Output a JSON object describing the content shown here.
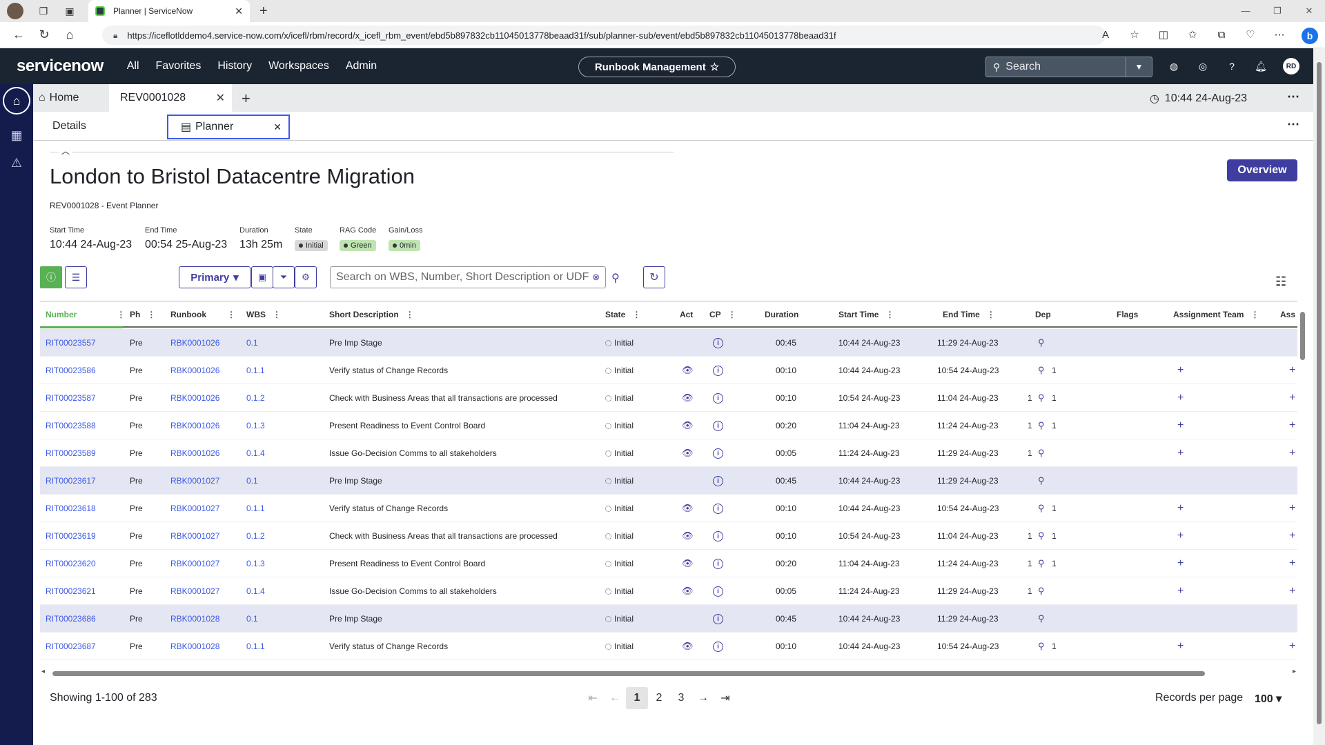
{
  "browser": {
    "tab_title": "Planner | ServiceNow",
    "url": "https://iceflotlddemo4.service-now.com/x/icefl/rbm/record/x_icefl_rbm_event/ebd5b897832cb11045013778beaad31f/sub/planner-sub/event/ebd5b897832cb11045013778beaad31f"
  },
  "header": {
    "logo": "servicenow",
    "nav": [
      "All",
      "Favorites",
      "History",
      "Workspaces",
      "Admin"
    ],
    "context": "Runbook Management",
    "search_label": "Search",
    "user_initials": "RD"
  },
  "workspace_tabs": {
    "home": "Home",
    "record": "REV0001028",
    "time": "10:44 24-Aug-23"
  },
  "sub_tabs": {
    "details": "Details",
    "planner": "Planner"
  },
  "page": {
    "title": "London to Bristol Datacentre Migration",
    "subtitle": "REV0001028 - Event Planner",
    "overview_button": "Overview"
  },
  "meta": {
    "start_time_label": "Start Time",
    "start_time": "10:44 24-Aug-23",
    "end_time_label": "End Time",
    "end_time": "00:54 25-Aug-23",
    "duration_label": "Duration",
    "duration": "13h 25m",
    "state_label": "State",
    "state": "Initial",
    "rag_label": "RAG Code",
    "rag": "Green",
    "gain_label": "Gain/Loss",
    "gain": "0min"
  },
  "toolbar": {
    "primary": "Primary",
    "search_placeholder": "Search on WBS, Number, Short Description or UDF"
  },
  "table": {
    "headers": {
      "number": "Number",
      "phase": "Ph",
      "runbook": "Runbook",
      "wbs": "WBS",
      "desc": "Short Description",
      "state": "State",
      "act": "Act",
      "cp": "CP",
      "duration": "Duration",
      "start": "Start Time",
      "end": "End Time",
      "dep": "Dep",
      "flags": "Flags",
      "team": "Assignment Team",
      "ass": "Ass"
    },
    "rows": [
      {
        "number": "RIT00023557",
        "phase": "Pre",
        "runbook": "RBK0001026",
        "wbs": "0.1",
        "desc": "Pre Imp Stage",
        "state": "Initial",
        "act": false,
        "duration": "00:45",
        "start": "10:44 24-Aug-23",
        "end": "11:29 24-Aug-23",
        "dep_pre": "",
        "dep_post": "",
        "stage": true
      },
      {
        "number": "RIT00023586",
        "phase": "Pre",
        "runbook": "RBK0001026",
        "wbs": "0.1.1",
        "desc": "Verify status of Change Records",
        "state": "Initial",
        "act": true,
        "duration": "00:10",
        "start": "10:44 24-Aug-23",
        "end": "10:54 24-Aug-23",
        "dep_pre": "",
        "dep_post": "1",
        "stage": false
      },
      {
        "number": "RIT00023587",
        "phase": "Pre",
        "runbook": "RBK0001026",
        "wbs": "0.1.2",
        "desc": "Check with Business Areas that all transactions are processed",
        "state": "Initial",
        "act": true,
        "duration": "00:10",
        "start": "10:54 24-Aug-23",
        "end": "11:04 24-Aug-23",
        "dep_pre": "1",
        "dep_post": "1",
        "stage": false
      },
      {
        "number": "RIT00023588",
        "phase": "Pre",
        "runbook": "RBK0001026",
        "wbs": "0.1.3",
        "desc": "Present Readiness to Event Control Board",
        "state": "Initial",
        "act": true,
        "duration": "00:20",
        "start": "11:04 24-Aug-23",
        "end": "11:24 24-Aug-23",
        "dep_pre": "1",
        "dep_post": "1",
        "stage": false
      },
      {
        "number": "RIT00023589",
        "phase": "Pre",
        "runbook": "RBK0001026",
        "wbs": "0.1.4",
        "desc": "Issue Go-Decision Comms to all stakeholders",
        "state": "Initial",
        "act": true,
        "duration": "00:05",
        "start": "11:24 24-Aug-23",
        "end": "11:29 24-Aug-23",
        "dep_pre": "1",
        "dep_post": "",
        "stage": false
      },
      {
        "number": "RIT00023617",
        "phase": "Pre",
        "runbook": "RBK0001027",
        "wbs": "0.1",
        "desc": "Pre Imp Stage",
        "state": "Initial",
        "act": false,
        "duration": "00:45",
        "start": "10:44 24-Aug-23",
        "end": "11:29 24-Aug-23",
        "dep_pre": "",
        "dep_post": "",
        "stage": true
      },
      {
        "number": "RIT00023618",
        "phase": "Pre",
        "runbook": "RBK0001027",
        "wbs": "0.1.1",
        "desc": "Verify status of Change Records",
        "state": "Initial",
        "act": true,
        "duration": "00:10",
        "start": "10:44 24-Aug-23",
        "end": "10:54 24-Aug-23",
        "dep_pre": "",
        "dep_post": "1",
        "stage": false
      },
      {
        "number": "RIT00023619",
        "phase": "Pre",
        "runbook": "RBK0001027",
        "wbs": "0.1.2",
        "desc": "Check with Business Areas that all transactions are processed",
        "state": "Initial",
        "act": true,
        "duration": "00:10",
        "start": "10:54 24-Aug-23",
        "end": "11:04 24-Aug-23",
        "dep_pre": "1",
        "dep_post": "1",
        "stage": false
      },
      {
        "number": "RIT00023620",
        "phase": "Pre",
        "runbook": "RBK0001027",
        "wbs": "0.1.3",
        "desc": "Present Readiness to Event Control Board",
        "state": "Initial",
        "act": true,
        "duration": "00:20",
        "start": "11:04 24-Aug-23",
        "end": "11:24 24-Aug-23",
        "dep_pre": "1",
        "dep_post": "1",
        "stage": false
      },
      {
        "number": "RIT00023621",
        "phase": "Pre",
        "runbook": "RBK0001027",
        "wbs": "0.1.4",
        "desc": "Issue Go-Decision Comms to all stakeholders",
        "state": "Initial",
        "act": true,
        "duration": "00:05",
        "start": "11:24 24-Aug-23",
        "end": "11:29 24-Aug-23",
        "dep_pre": "1",
        "dep_post": "",
        "stage": false
      },
      {
        "number": "RIT00023686",
        "phase": "Pre",
        "runbook": "RBK0001028",
        "wbs": "0.1",
        "desc": "Pre Imp Stage",
        "state": "Initial",
        "act": false,
        "duration": "00:45",
        "start": "10:44 24-Aug-23",
        "end": "11:29 24-Aug-23",
        "dep_pre": "",
        "dep_post": "",
        "stage": true
      },
      {
        "number": "RIT00023687",
        "phase": "Pre",
        "runbook": "RBK0001028",
        "wbs": "0.1.1",
        "desc": "Verify status of Change Records",
        "state": "Initial",
        "act": true,
        "duration": "00:10",
        "start": "10:44 24-Aug-23",
        "end": "10:54 24-Aug-23",
        "dep_pre": "",
        "dep_post": "1",
        "stage": false
      }
    ]
  },
  "pagination": {
    "showing": "Showing 1-100 of 283",
    "pages": [
      "1",
      "2",
      "3"
    ],
    "current_page": "1",
    "records_per_page_label": "Records per page",
    "records_per_page": "100"
  }
}
